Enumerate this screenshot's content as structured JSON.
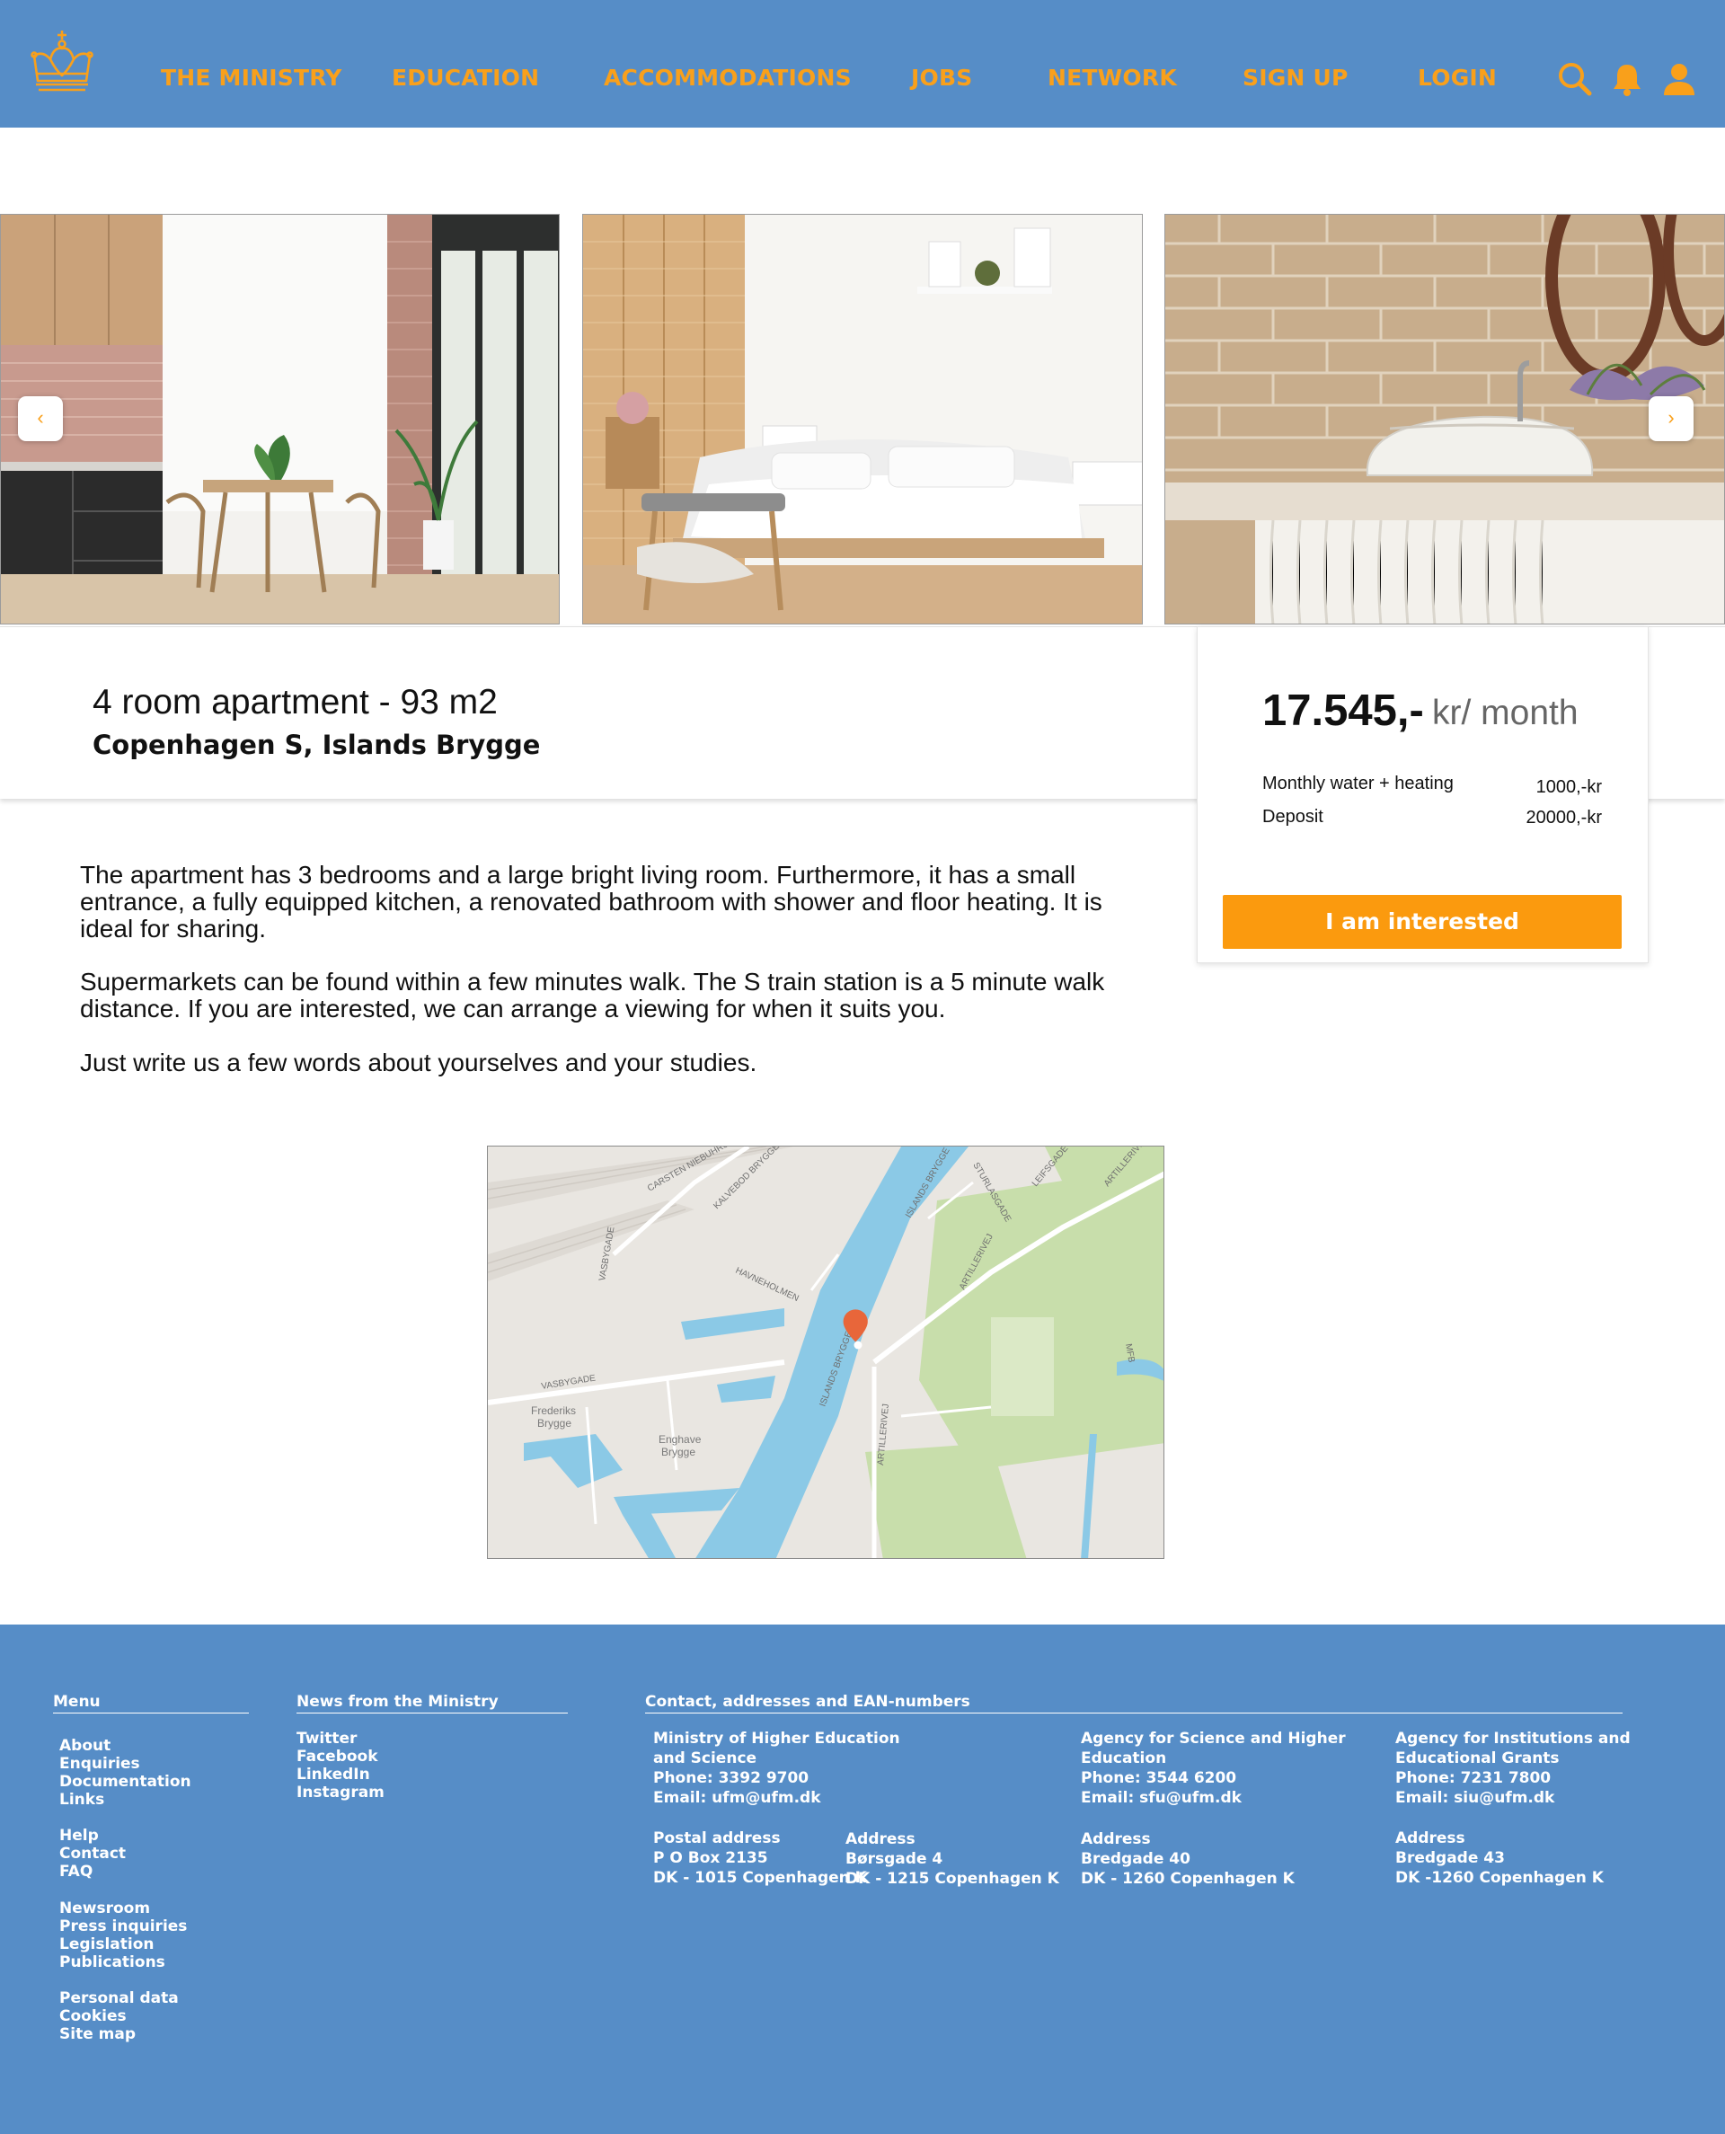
{
  "colors": {
    "header_bg": "#568dc7",
    "accent": "#f9a01b",
    "button": "#fb9a0e",
    "footer_bg": "#568dc7"
  },
  "header": {
    "logo": "crown-icon",
    "nav": [
      "THE MINISTRY",
      "EDUCATION",
      "ACCOMMODATIONS",
      "JOBS",
      "NETWORK",
      "SIGN UP",
      "LOGIN"
    ],
    "icons": [
      "search-icon",
      "bell-icon",
      "user-icon"
    ]
  },
  "gallery": {
    "photos": [
      "kitchen-dining-photo",
      "bedroom-photo",
      "bathroom-sink-photo"
    ],
    "prev_label": "‹",
    "next_label": "›"
  },
  "listing": {
    "title": "4 room apartment - 93 m2",
    "location": "Copenhagen S, Islands Brygge",
    "price": "17.545,-",
    "price_unit": "kr/ month",
    "fees": [
      {
        "label": "Monthly water + heating",
        "value": "1000,-kr"
      },
      {
        "label": "Deposit",
        "value": "20000,-kr"
      }
    ],
    "cta": "I am interested",
    "description": [
      "The apartment has 3 bedrooms and a large bright living room. Furthermore, it has a small entrance, a fully equipped kitchen, a renovated bathroom with shower and floor heating. It is ideal for sharing.",
      "Supermarkets can be found within a few minutes walk. The S train station is a 5 minute walk distance. If you are interested, we can arrange a viewing for when it suits you.",
      "Just write us a few words about yourselves and your studies."
    ]
  },
  "map": {
    "labels": {
      "vasbygade": "VASBYGADE",
      "frederiks": "Frederiks",
      "frederiks2": "Brygge",
      "enghave": "Enghave",
      "enghave2": "Brygge",
      "islands": "ISLANDS BRYGGE",
      "artilleri": "ARTILLERIVEJ",
      "havneholmen": "HAVNEHOLMEN",
      "kalvebod": "KALVEBOD BRYGGE",
      "carsten": "CARSTEN NIEBUHRS G",
      "sturla": "STURLASGADE",
      "leifs": "LEIFSGADE",
      "mfb": "MFB"
    }
  },
  "footer": {
    "menu_heading": "Menu",
    "menu_groups": [
      [
        "About",
        "Enquiries",
        "Documentation",
        "Links"
      ],
      [
        "Help",
        "Contact",
        "FAQ"
      ],
      [
        "Newsroom",
        "Press inquiries",
        "Legislation",
        "Publications"
      ],
      [
        "Personal data",
        "Cookies",
        "Site map"
      ]
    ],
    "news_heading": "News from the Ministry",
    "news_links": [
      "Twitter",
      "Facebook",
      "LinkedIn",
      "Instagram"
    ],
    "contact_heading": "Contact, addresses and EAN-numbers",
    "ministry": {
      "name": [
        "Ministry of Higher Education",
        "and Science"
      ],
      "phone": "Phone: 3392 9700",
      "email": "Email: ufm@ufm.dk",
      "postal": [
        "Postal address",
        "P O Box 2135",
        "DK - 1015 Copenhagen K"
      ],
      "address": [
        "Address",
        "Børsgade 4",
        "DK - 1215 Copenhagen K"
      ]
    },
    "agency_science": {
      "name": [
        "Agency for Science and Higher",
        "Education"
      ],
      "phone": "Phone: 3544 6200",
      "email": "Email: sfu@ufm.dk",
      "address": [
        "Address",
        "Bredgade 40",
        "DK - 1260 Copenhagen K"
      ]
    },
    "agency_institutions": {
      "name": [
        "Agency for Institutions and",
        "Educational Grants"
      ],
      "phone": "Phone: 7231 7800",
      "email": "Email: siu@ufm.dk",
      "address": [
        "Address",
        "Bredgade 43",
        "DK -1260 Copenhagen K"
      ]
    }
  }
}
